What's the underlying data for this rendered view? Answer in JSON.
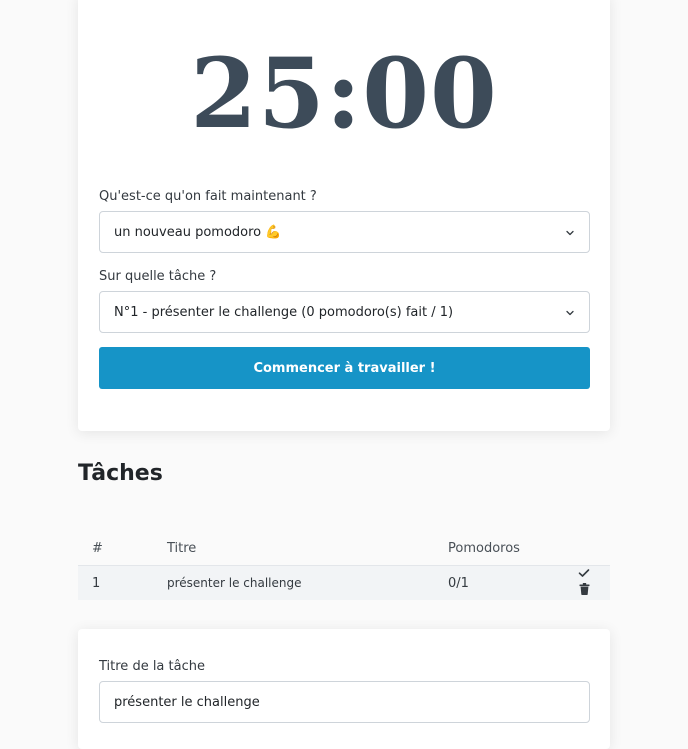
{
  "timer": {
    "display": "25:00"
  },
  "activity": {
    "label": "Qu'est-ce qu'on fait maintenant ?",
    "selected": "un nouveau pomodoro 💪"
  },
  "task_select": {
    "label": "Sur quelle tâche ?",
    "selected": "N°1 - présenter le challenge (0 pomodoro(s) fait / 1)"
  },
  "start_button": {
    "label": "Commencer à travailler !"
  },
  "tasks": {
    "heading": "Tâches",
    "columns": [
      "#",
      "Titre",
      "Pomodoros"
    ],
    "rows": [
      {
        "num": "1",
        "title": "présenter le challenge",
        "pomodoros": "0/1"
      }
    ]
  },
  "task_form": {
    "title_label": "Titre de la tâche",
    "title_value": "présenter le challenge"
  },
  "icons": [
    "chevron-down-icon",
    "check-icon",
    "trash-icon"
  ],
  "colors": {
    "primary_button": "#1694c7",
    "timer_text": "#3d4b59"
  }
}
